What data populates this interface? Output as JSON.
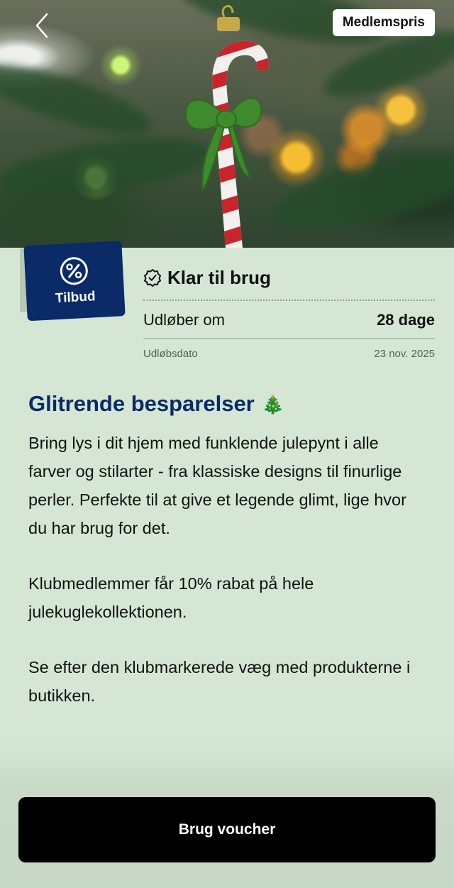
{
  "hero": {
    "badge_label": "Medlemspris"
  },
  "offer_tag": {
    "label": "Tilbud",
    "icon": "percent-badge-icon"
  },
  "status": {
    "label": "Klar til brug",
    "icon": "verified-badge-icon"
  },
  "expiry": {
    "label": "Udløber om",
    "value": "28 dage",
    "date_label": "Udløbsdato",
    "date_value": "23 nov. 2025"
  },
  "content": {
    "title": "Glitrende besparelser",
    "title_emoji": "🎄",
    "paragraphs": [
      "Bring lys i dit hjem med funklende julepynt i alle farver og stilarter - fra klassiske designs til finurlige perler. Perfekte til at give et legende glimt, lige hvor du har brug for det.",
      "Klubmedlemmer får 10% rabat på hele julekuglekollektionen.",
      "Se efter den klubmarkerede væg med produkterne i butikken."
    ]
  },
  "cta": {
    "label": "Brug voucher"
  },
  "colors": {
    "background": "#d5e7d4",
    "brand_navy": "#0a2a68",
    "cta_bg": "#000000"
  }
}
